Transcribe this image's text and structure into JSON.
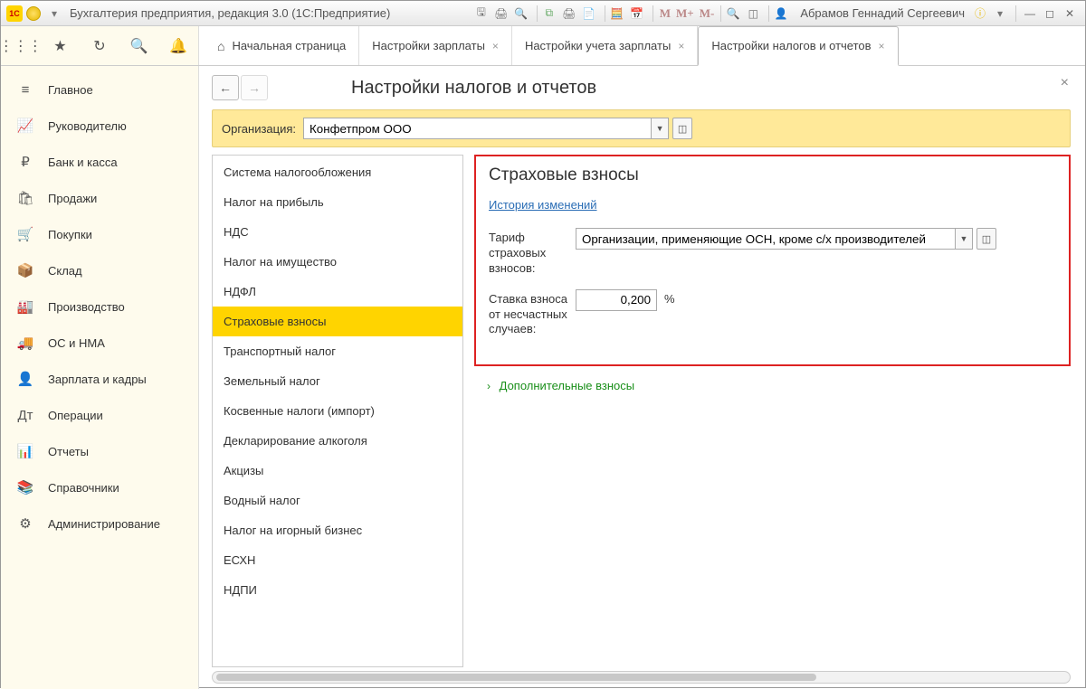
{
  "titlebar": {
    "app_title": "Бухгалтерия предприятия, редакция 3.0  (1С:Предприятие)",
    "user": "Абрамов Геннадий Сергеевич",
    "mem_buttons": [
      "M",
      "M+",
      "M-"
    ]
  },
  "tabs": {
    "home": "Начальная страница",
    "items": [
      {
        "label": "Настройки зарплаты",
        "closable": true,
        "active": false
      },
      {
        "label": "Настройки учета зарплаты",
        "closable": true,
        "active": false
      },
      {
        "label": "Настройки налогов и отчетов",
        "closable": true,
        "active": true
      }
    ]
  },
  "sidebar": {
    "items": [
      {
        "icon": "≡",
        "label": "Главное"
      },
      {
        "icon": "📈",
        "label": "Руководителю"
      },
      {
        "icon": "₽",
        "label": "Банк и касса"
      },
      {
        "icon": "🛍",
        "label": "Продажи"
      },
      {
        "icon": "🛒",
        "label": "Покупки"
      },
      {
        "icon": "📦",
        "label": "Склад"
      },
      {
        "icon": "🏭",
        "label": "Производство"
      },
      {
        "icon": "🚚",
        "label": "ОС и НМА"
      },
      {
        "icon": "👤",
        "label": "Зарплата и кадры"
      },
      {
        "icon": "Дт",
        "label": "Операции"
      },
      {
        "icon": "📊",
        "label": "Отчеты"
      },
      {
        "icon": "📚",
        "label": "Справочники"
      },
      {
        "icon": "⚙",
        "label": "Администрирование"
      }
    ]
  },
  "page": {
    "title": "Настройки налогов и отчетов",
    "org_label": "Организация:",
    "org_value": "Конфетпром ООО"
  },
  "categories": [
    "Система налогообложения",
    "Налог на прибыль",
    "НДС",
    "Налог на имущество",
    "НДФЛ",
    "Страховые взносы",
    "Транспортный налог",
    "Земельный налог",
    "Косвенные налоги (импорт)",
    "Декларирование алкоголя",
    "Акцизы",
    "Водный налог",
    "Налог на игорный бизнес",
    "ЕСХН",
    "НДПИ"
  ],
  "categories_selected_index": 5,
  "detail": {
    "section_title": "Страховые взносы",
    "history_link": "История изменений",
    "tarif_label": "Тариф страховых взносов:",
    "tarif_value": "Организации, применяющие ОСН, кроме с/х производителей",
    "rate_label": "Ставка взноса от несчастных случаев:",
    "rate_value": "0,200",
    "rate_unit": "%",
    "expander": "Дополнительные взносы"
  }
}
